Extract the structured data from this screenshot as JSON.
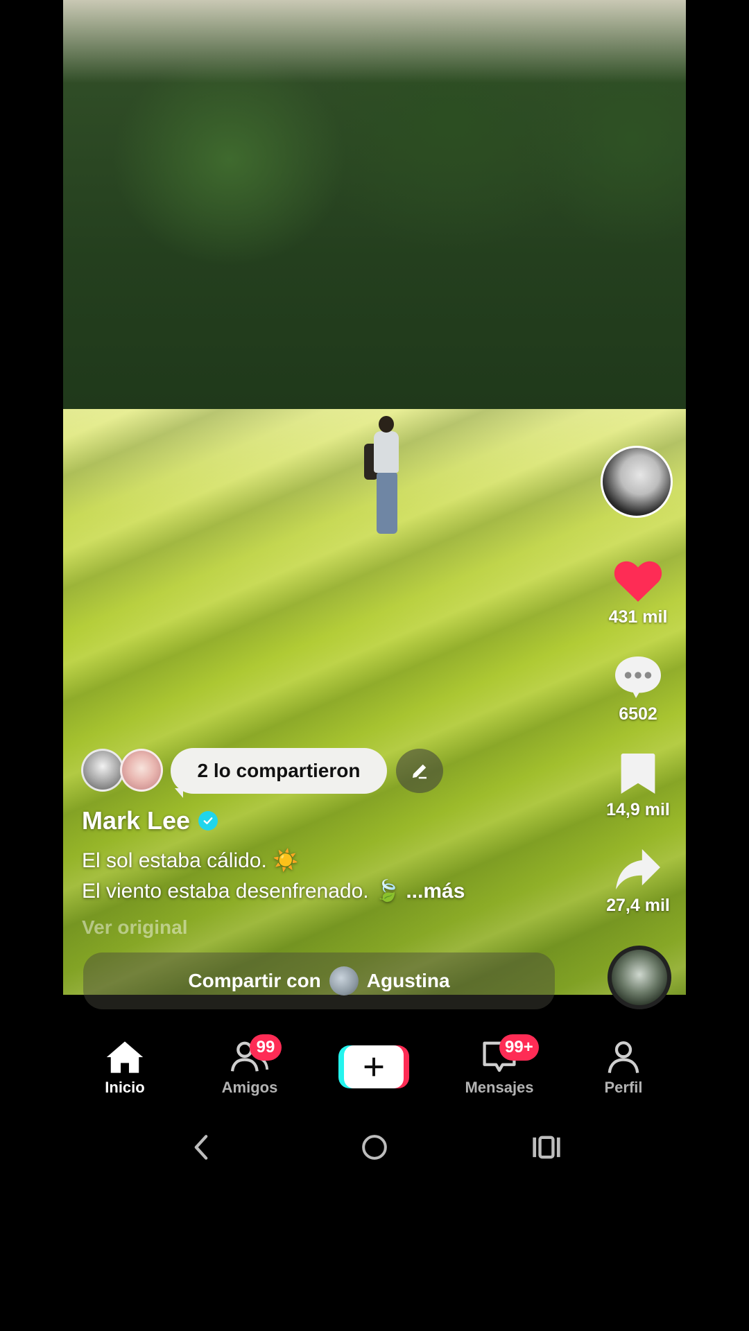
{
  "video": {
    "scene": "person-running-in-field"
  },
  "rail": {
    "creator_avatar": "creator-avatar",
    "like": {
      "count": "431 mil",
      "icon": "heart-icon",
      "color": "#fe2c55"
    },
    "comment": {
      "count": "6502",
      "icon": "comment-icon"
    },
    "save": {
      "count": "14,9 mil",
      "icon": "bookmark-icon"
    },
    "share": {
      "count": "27,4 mil",
      "icon": "share-arrow-icon"
    }
  },
  "caption": {
    "shared_label": "2 lo compartieron",
    "author": "Mark Lee",
    "verified_color": "#20d5ec",
    "line1": "El sol estaba cálido. ☀️",
    "line2": "El viento estaba desenfrenado. 🍃",
    "more": "...más",
    "translate": "Ver original"
  },
  "share_bar": {
    "prefix": "Compartir con",
    "name": "Agustina"
  },
  "nav": {
    "home": "Inicio",
    "friends": "Amigos",
    "friends_badge": "99",
    "messages": "Mensajes",
    "messages_badge": "99+",
    "profile": "Perfil",
    "badge_color": "#fe2c55"
  }
}
